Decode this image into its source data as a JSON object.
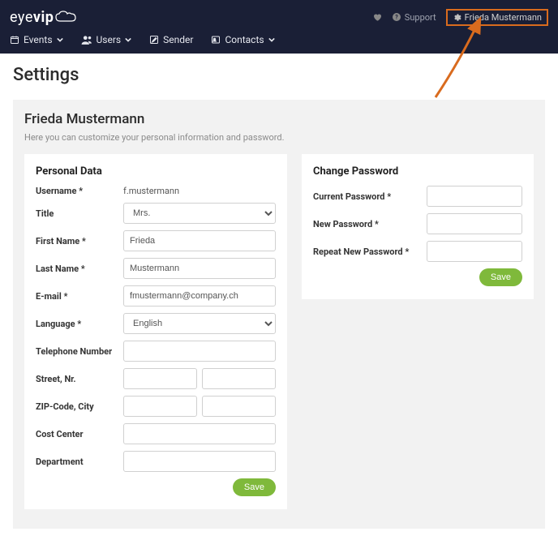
{
  "header": {
    "logo_text": "eyevip",
    "support_label": "Support",
    "user_name": "Frieda Mustermann"
  },
  "nav": {
    "events": "Events",
    "users": "Users",
    "sender": "Sender",
    "contacts": "Contacts"
  },
  "page": {
    "title": "Settings",
    "profile_name": "Frieda Mustermann",
    "hint": "Here you can customize your personal information and password."
  },
  "personal": {
    "heading": "Personal Data",
    "username_label": "Username *",
    "username_value": "f.mustermann",
    "title_label": "Title",
    "title_value": "Mrs.",
    "firstname_label": "First Name *",
    "firstname_value": "Frieda",
    "lastname_label": "Last Name *",
    "lastname_value": "Mustermann",
    "email_label": "E-mail *",
    "email_value": "fmustermann@company.ch",
    "language_label": "Language *",
    "language_value": "English",
    "telephone_label": "Telephone Number",
    "telephone_value": "",
    "street_label": "Street, Nr.",
    "street_value": "",
    "street_nr_value": "",
    "zip_label": "ZIP-Code, City",
    "zip_value": "",
    "city_value": "",
    "costcenter_label": "Cost Center",
    "costcenter_value": "",
    "department_label": "Department",
    "department_value": "",
    "save_label": "Save"
  },
  "password": {
    "heading": "Change Password",
    "current_label": "Current Password *",
    "new_label": "New Password *",
    "repeat_label": "Repeat New Password *",
    "save_label": "Save"
  }
}
